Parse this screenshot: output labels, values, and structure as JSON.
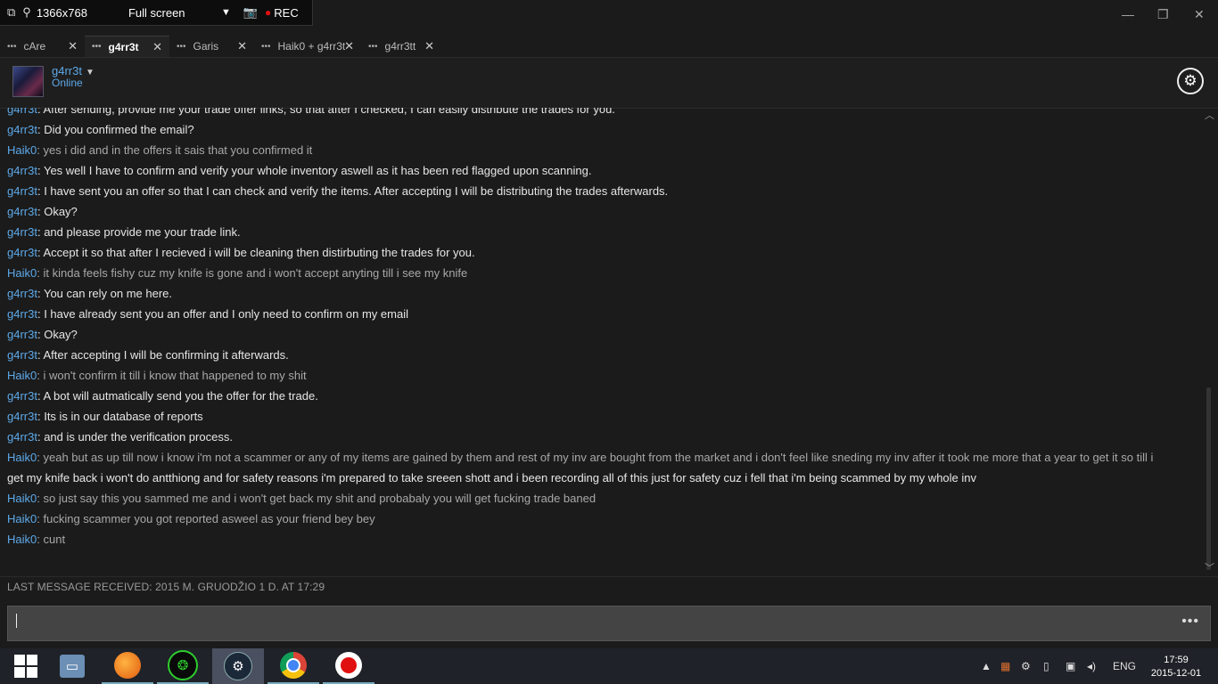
{
  "recorder": {
    "resolution": "1366x768",
    "mode": "Full screen",
    "rec_label": "REC"
  },
  "window_controls": {
    "minimize": "—",
    "maximize": "❐",
    "close": "✕"
  },
  "tabs": [
    {
      "label": "cAre",
      "close": "✕"
    },
    {
      "label": "g4rr3t",
      "close": "✕"
    },
    {
      "label": "Garis",
      "close": "✕"
    },
    {
      "label": "Haik0 + g4rr3t",
      "close": "✕"
    },
    {
      "label": "g4rr3tt",
      "close": "✕"
    }
  ],
  "tab_dots": "•••",
  "chat_header": {
    "name": "g4rr3t",
    "status": "Online"
  },
  "messages": [
    {
      "from": "g4rr3t",
      "self": false,
      "text": "After sending, provide me your trade offer links, so that after I checked, I can easily distribute the trades for you."
    },
    {
      "from": "g4rr3t",
      "self": false,
      "text": "Did you confirmed the email?"
    },
    {
      "from": "Haik0",
      "self": true,
      "text": "yes i did and in the offers it sais that you confirmed it"
    },
    {
      "from": "g4rr3t",
      "self": false,
      "text": "Yes well I have to confirm and verify your whole inventory aswell as it has been red flagged upon scanning."
    },
    {
      "from": "g4rr3t",
      "self": false,
      "text": "I have sent you an offer so that I can check and verify the items. After accepting I will be distributing the trades afterwards."
    },
    {
      "from": "g4rr3t",
      "self": false,
      "text": "Okay?"
    },
    {
      "from": "g4rr3t",
      "self": false,
      "text": "and please provide me your trade link."
    },
    {
      "from": "g4rr3t",
      "self": false,
      "text": "Accept it so that after I recieved i will be cleaning then distirbuting the trades for you."
    },
    {
      "from": "Haik0",
      "self": true,
      "text": "it kinda feels fishy cuz my knife is gone and i won't accept anyting till i see my knife"
    },
    {
      "from": "g4rr3t",
      "self": false,
      "text": "You can rely on me here."
    },
    {
      "from": "g4rr3t",
      "self": false,
      "text": "I have already sent you an offer and I only need to confirm on my email"
    },
    {
      "from": "g4rr3t",
      "self": false,
      "text": "Okay?"
    },
    {
      "from": "g4rr3t",
      "self": false,
      "text": "After accepting I will be confirming it afterwards."
    },
    {
      "from": "Haik0",
      "self": true,
      "text": "i won't confirm it till i know that happened to my shit"
    },
    {
      "from": "g4rr3t",
      "self": false,
      "text": "A bot will autmatically send you the offer for the trade."
    },
    {
      "from": "g4rr3t",
      "self": false,
      "text": "Its is in our database of reports"
    },
    {
      "from": "g4rr3t",
      "self": false,
      "text": "and is under the verification process."
    },
    {
      "from": "Haik0",
      "self": true,
      "text": "yeah but as up till now i know i'm not a scammer or any of my items are gained by them and rest of my inv are bought from the market and i don't feel like sneding my inv after it took me more that a year to get it so till i",
      "continuation": "get my knife back i won't do antthiong and for safety reasons i'm prepared to take sreeen shott and i been recording all of this just for safety cuz i fell that i'm being scammed by my whole inv"
    },
    {
      "from": "Haik0",
      "self": true,
      "text": "so just say this you sammed me and i won't get back my shit and probabaly you will get fucking trade baned"
    },
    {
      "from": "Haik0",
      "self": true,
      "text": "fucking scammer you got  reported asweel as your friend bey bey"
    },
    {
      "from": "Haik0",
      "self": true,
      "text": "cunt"
    }
  ],
  "last_message_received": "LAST MESSAGE RECEIVED: 2015 M. GRUODŽIO 1 D. AT 17:29",
  "input": {
    "value": "",
    "more": "•••"
  },
  "taskbar": {
    "apps": [
      "windows-start",
      "file-explorer",
      "firefox",
      "razer-cortex",
      "steam",
      "chrome",
      "recorder"
    ],
    "language": "ENG",
    "time": "17:59",
    "date": "2015-12-01"
  },
  "colors": {
    "username_blue": "#5da9e9",
    "bg": "#1b1b1b",
    "input_bg": "#444444"
  }
}
